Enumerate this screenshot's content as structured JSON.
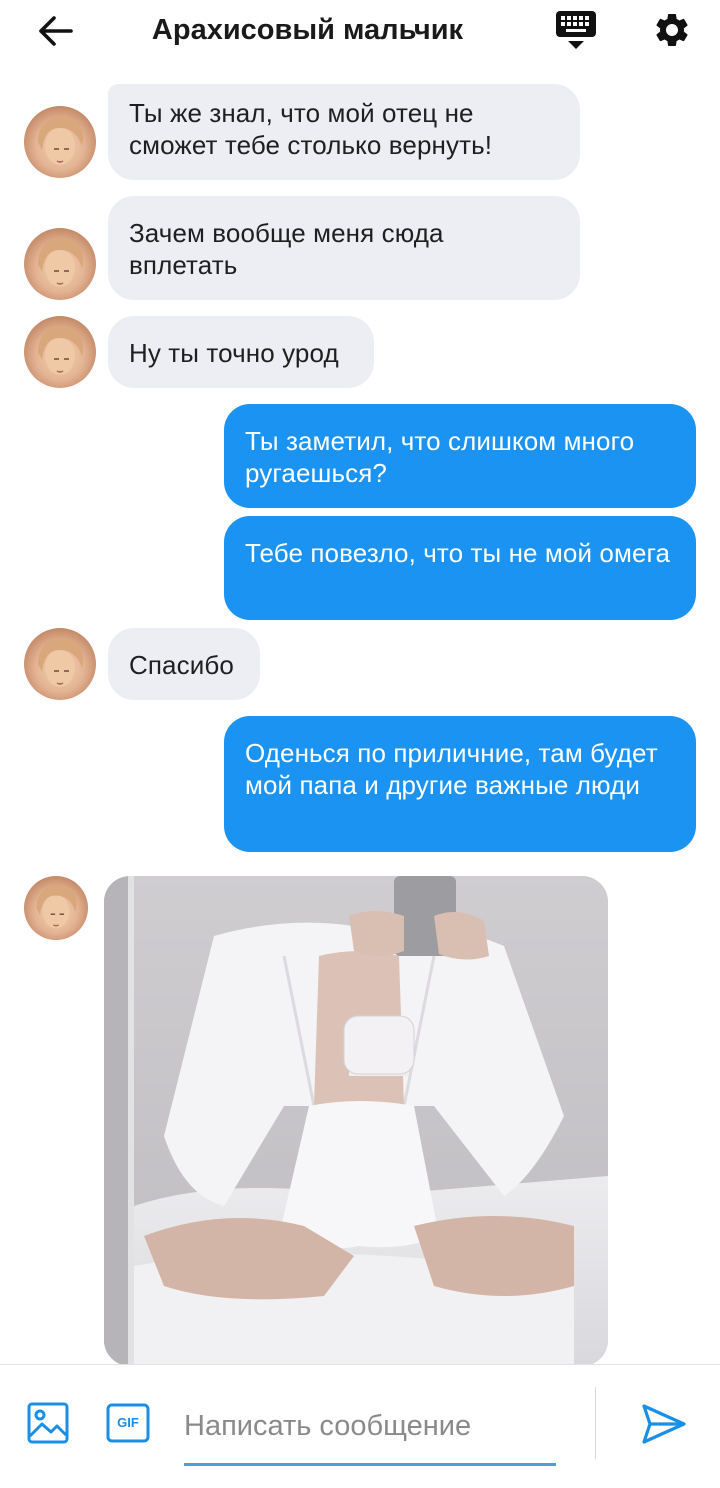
{
  "header": {
    "back_icon": "arrow-left-icon",
    "title": "Арахисовый мальчик",
    "keyboard_icon": "keyboard-hide-icon",
    "settings_icon": "gear-icon"
  },
  "messages": [
    {
      "from": "contact",
      "text": "Ты же знал, что мой отец не сможет тебе столько вернуть!"
    },
    {
      "from": "contact",
      "text": "Зачем вообще меня сюда вплетать"
    },
    {
      "from": "contact",
      "text": "Ну ты точно урод"
    },
    {
      "from": "me",
      "text": "Ты заметил, что слишком много ругаешься?"
    },
    {
      "from": "me",
      "text": "Тебе повезло, что ты не мой омега"
    },
    {
      "from": "contact",
      "text": "Спасибо"
    },
    {
      "from": "me",
      "text": "Оденься по приличние, там будет мой папа и другие важные люди"
    },
    {
      "from": "contact",
      "type": "image"
    }
  ],
  "composer": {
    "image_icon": "image-icon",
    "gif_label": "GIF",
    "placeholder": "Написать сообщение",
    "send_icon": "send-icon"
  },
  "colors": {
    "outgoing_bubble": "#1a93f2",
    "incoming_bubble": "#eceef4",
    "accent": "#1a8fe6"
  }
}
